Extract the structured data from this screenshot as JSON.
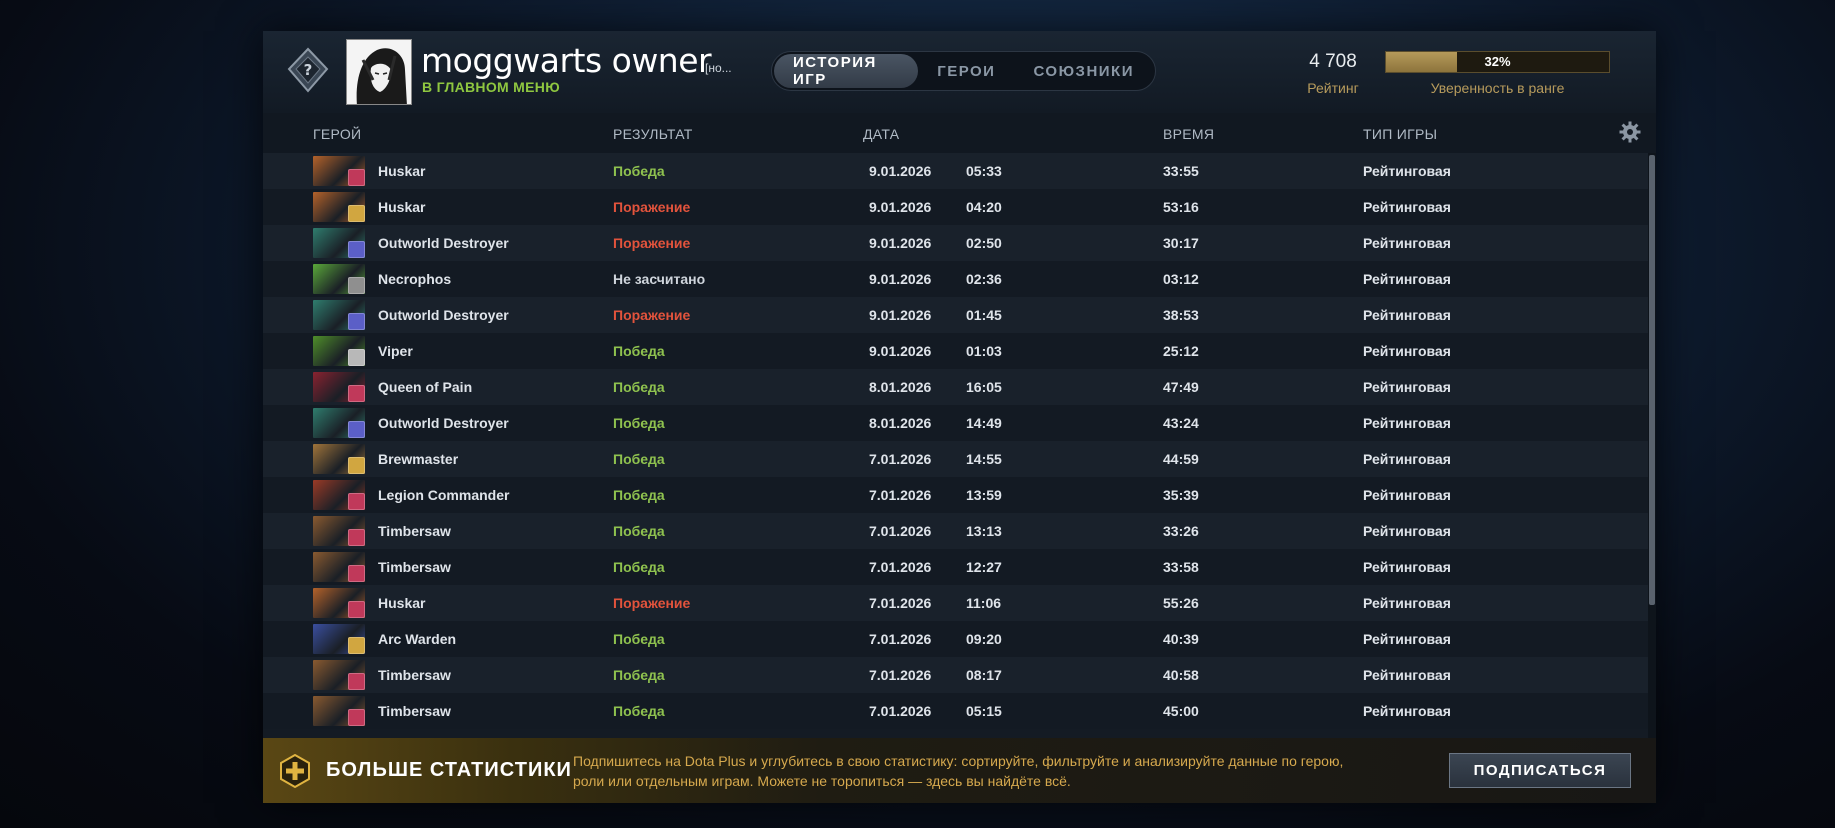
{
  "header": {
    "player_name": "moggwarts owner",
    "player_tag": "[но...",
    "status": "В ГЛАВНОМ МЕНЮ",
    "tabs": [
      {
        "label": "ИСТОРИЯ ИГР",
        "active": true
      },
      {
        "label": "ГЕРОИ",
        "active": false
      },
      {
        "label": "СОЮЗНИКИ",
        "active": false
      }
    ],
    "rating_value": "4 708",
    "rating_label": "Рейтинг",
    "confidence_percent": 32,
    "confidence_text": "32%",
    "confidence_label": "Уверенность в ранге"
  },
  "table": {
    "columns": {
      "hero": "ГЕРОЙ",
      "result": "РЕЗУЛЬТАТ",
      "date": "ДАТА",
      "duration": "ВРЕМЯ",
      "type": "ТИП ИГРЫ"
    },
    "rows": [
      {
        "hero": "Huskar",
        "result": "Победа",
        "outcome": "win",
        "date": "9.01.2026",
        "time": "05:33",
        "duration": "33:55",
        "type": "Рейтинговая",
        "hero_color": "#b4622a",
        "role_color": "#c0395a"
      },
      {
        "hero": "Huskar",
        "result": "Поражение",
        "outcome": "loss",
        "date": "9.01.2026",
        "time": "04:20",
        "duration": "53:16",
        "type": "Рейтинговая",
        "hero_color": "#b4622a",
        "role_color": "#d1a640"
      },
      {
        "hero": "Outworld Destroyer",
        "result": "Поражение",
        "outcome": "loss",
        "date": "9.01.2026",
        "time": "02:50",
        "duration": "30:17",
        "type": "Рейтинговая",
        "hero_color": "#2f7d6e",
        "role_color": "#5b5fc7"
      },
      {
        "hero": "Necrophos",
        "result": "Не засчитано",
        "outcome": "nc",
        "date": "9.01.2026",
        "time": "02:36",
        "duration": "03:12",
        "type": "Рейтинговая",
        "hero_color": "#5aa83a",
        "role_color": "#8f8f8f"
      },
      {
        "hero": "Outworld Destroyer",
        "result": "Поражение",
        "outcome": "loss",
        "date": "9.01.2026",
        "time": "01:45",
        "duration": "38:53",
        "type": "Рейтинговая",
        "hero_color": "#2f7d6e",
        "role_color": "#5b5fc7"
      },
      {
        "hero": "Viper",
        "result": "Победа",
        "outcome": "win",
        "date": "9.01.2026",
        "time": "01:03",
        "duration": "25:12",
        "type": "Рейтинговая",
        "hero_color": "#4f8f2a",
        "role_color": "#b8b8b8"
      },
      {
        "hero": "Queen of Pain",
        "result": "Победа",
        "outcome": "win",
        "date": "8.01.2026",
        "time": "16:05",
        "duration": "47:49",
        "type": "Рейтинговая",
        "hero_color": "#8a2230",
        "role_color": "#c0395a"
      },
      {
        "hero": "Outworld Destroyer",
        "result": "Победа",
        "outcome": "win",
        "date": "8.01.2026",
        "time": "14:49",
        "duration": "43:24",
        "type": "Рейтинговая",
        "hero_color": "#2f7d6e",
        "role_color": "#5b5fc7"
      },
      {
        "hero": "Brewmaster",
        "result": "Победа",
        "outcome": "win",
        "date": "7.01.2026",
        "time": "14:55",
        "duration": "44:59",
        "type": "Рейтинговая",
        "hero_color": "#a0743a",
        "role_color": "#d1a640"
      },
      {
        "hero": "Legion Commander",
        "result": "Победа",
        "outcome": "win",
        "date": "7.01.2026",
        "time": "13:59",
        "duration": "35:39",
        "type": "Рейтинговая",
        "hero_color": "#9a3a26",
        "role_color": "#c0395a"
      },
      {
        "hero": "Timbersaw",
        "result": "Победа",
        "outcome": "win",
        "date": "7.01.2026",
        "time": "13:13",
        "duration": "33:26",
        "type": "Рейтинговая",
        "hero_color": "#8a5a30",
        "role_color": "#c0395a"
      },
      {
        "hero": "Timbersaw",
        "result": "Победа",
        "outcome": "win",
        "date": "7.01.2026",
        "time": "12:27",
        "duration": "33:58",
        "type": "Рейтинговая",
        "hero_color": "#8a5a30",
        "role_color": "#c0395a"
      },
      {
        "hero": "Huskar",
        "result": "Поражение",
        "outcome": "loss",
        "date": "7.01.2026",
        "time": "11:06",
        "duration": "55:26",
        "type": "Рейтинговая",
        "hero_color": "#b4622a",
        "role_color": "#c0395a"
      },
      {
        "hero": "Arc Warden",
        "result": "Победа",
        "outcome": "win",
        "date": "7.01.2026",
        "time": "09:20",
        "duration": "40:39",
        "type": "Рейтинговая",
        "hero_color": "#3a4fa0",
        "role_color": "#d1a640"
      },
      {
        "hero": "Timbersaw",
        "result": "Победа",
        "outcome": "win",
        "date": "7.01.2026",
        "time": "08:17",
        "duration": "40:58",
        "type": "Рейтинговая",
        "hero_color": "#8a5a30",
        "role_color": "#c0395a"
      },
      {
        "hero": "Timbersaw",
        "result": "Победа",
        "outcome": "win",
        "date": "7.01.2026",
        "time": "05:15",
        "duration": "45:00",
        "type": "Рейтинговая",
        "hero_color": "#8a5a30",
        "role_color": "#c0395a"
      }
    ]
  },
  "promo": {
    "title": "БОЛЬШЕ СТАТИСТИКИ",
    "text": "Подпишитесь на Dota Plus и углубитесь в свою статистику: сортируйте, фильтруйте и анализируйте данные по герою, роли или отдельным играм. Можете не торопиться — здесь вы найдёте всё.",
    "button": "ПОДПИСАТЬСЯ"
  },
  "icons": {
    "rank": "rank-unknown-icon",
    "settings": "gear-icon",
    "promo": "dota-plus-icon"
  },
  "colors": {
    "win": "#8fc24f",
    "loss": "#e2533c",
    "status_green": "#8fc740",
    "gold": "#b79b5c"
  }
}
